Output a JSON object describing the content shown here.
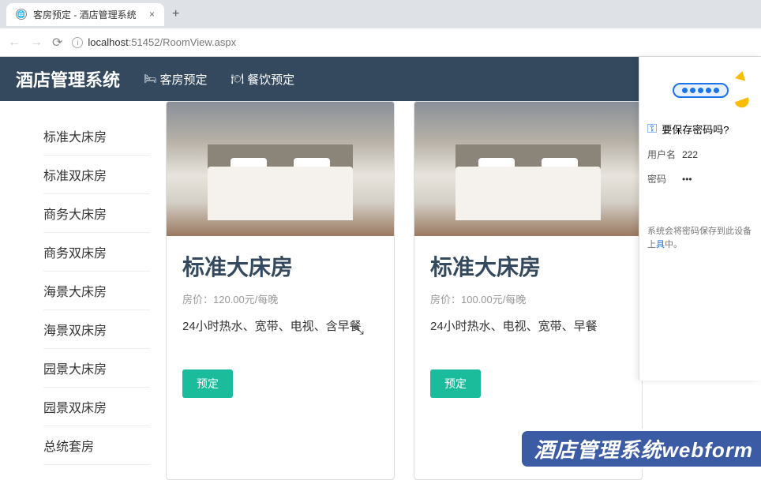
{
  "browser": {
    "tab_title": "客房预定 - 酒店管理系统",
    "url_host": "localhost",
    "url_port": ":51452",
    "url_path": "/RoomView.aspx"
  },
  "header": {
    "brand": "酒店管理系统",
    "nav1": "客房预定",
    "nav2": "餐饮预定"
  },
  "sidebar": {
    "items": [
      "标准大床房",
      "标准双床房",
      "商务大床房",
      "商务双床房",
      "海景大床房",
      "海景双床房",
      "园景大床房",
      "园景双床房",
      "总统套房"
    ]
  },
  "rooms": [
    {
      "title": "标准大床房",
      "price_label": "房价：120.00元/每晚",
      "desc": "24小时热水、宽带、电视、含早餐",
      "btn": "预定"
    },
    {
      "title": "标准大床房",
      "price_label": "房价：100.00元/每晚",
      "desc": "24小时热水、电视、宽带、早餐",
      "btn": "预定"
    }
  ],
  "pw_prompt": {
    "title": "要保存密码吗?",
    "user_label": "用户名",
    "user_value": "222",
    "pass_label": "密码",
    "pass_value": "•••",
    "note_pre": "系统会将密码保存到此设备上",
    "note_link": "具",
    "note_post": "中。"
  },
  "banner": "酒店管理系统webform"
}
